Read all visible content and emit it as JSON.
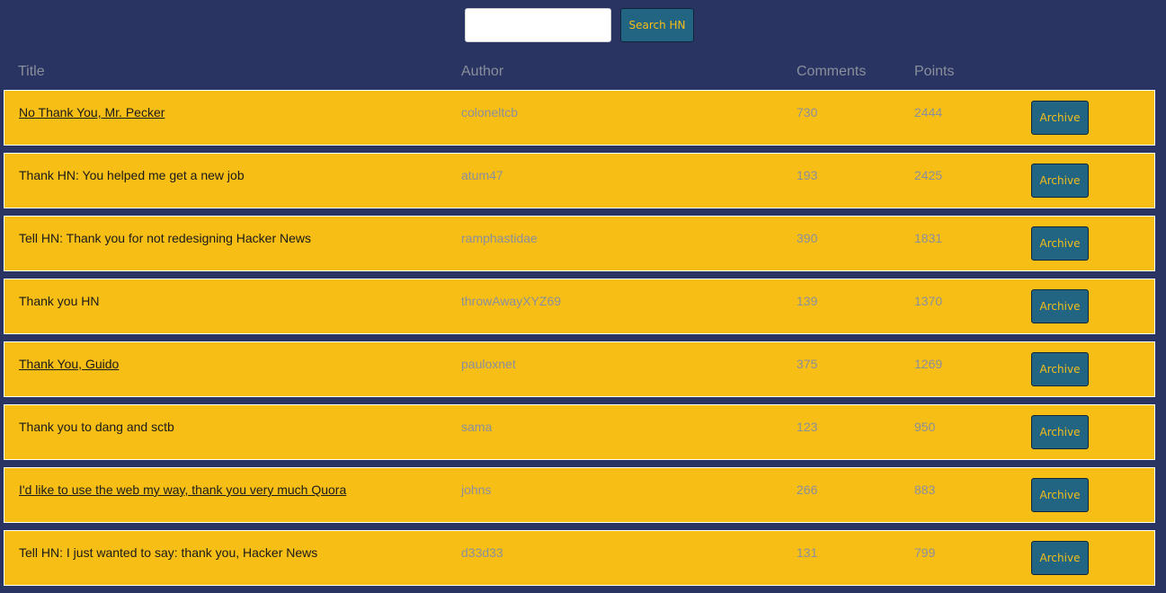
{
  "search": {
    "value": "",
    "placeholder": "",
    "button_label": "Search HN"
  },
  "table": {
    "headers": {
      "title": "Title",
      "author": "Author",
      "comments": "Comments",
      "points": "Points"
    },
    "archive_label": "Archive",
    "rows": [
      {
        "title": "No Thank You, Mr. Pecker",
        "linked": true,
        "author": "coloneltcb",
        "comments": "730",
        "points": "2444"
      },
      {
        "title": "Thank HN: You helped me get a new job",
        "linked": false,
        "author": "atum47",
        "comments": "193",
        "points": "2425"
      },
      {
        "title": "Tell HN: Thank you for not redesigning Hacker News",
        "linked": false,
        "author": "ramphastidae",
        "comments": "390",
        "points": "1831"
      },
      {
        "title": "Thank you HN",
        "linked": false,
        "author": "throwAwayXYZ69",
        "comments": "139",
        "points": "1370"
      },
      {
        "title": "Thank You, Guido",
        "linked": true,
        "author": "pauloxnet",
        "comments": "375",
        "points": "1269"
      },
      {
        "title": "Thank you to dang and sctb",
        "linked": false,
        "author": "sama",
        "comments": "123",
        "points": "950"
      },
      {
        "title": "I'd like to use the web my way, thank you very much Quora",
        "linked": true,
        "author": "johns",
        "comments": "266",
        "points": "883"
      },
      {
        "title": "Tell HN: I just wanted to say: thank you, Hacker News",
        "linked": false,
        "author": "d33d33",
        "comments": "131",
        "points": "799"
      }
    ]
  },
  "colors": {
    "background": "#293462",
    "row_background": "#f7be16",
    "button_background": "#216583",
    "button_text": "#f7be16",
    "muted_text": "#8a8f9c"
  }
}
